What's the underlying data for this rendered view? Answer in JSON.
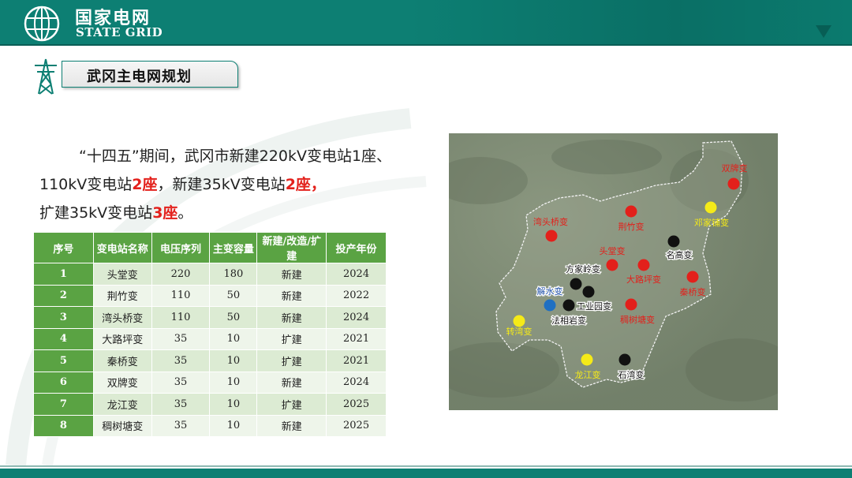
{
  "header": {
    "brand_cn": "国家电网",
    "brand_en": "STATE GRID",
    "colors": {
      "brand": "#0d7f73",
      "accent_red": "#e3201b",
      "table_green": "#5aa343"
    }
  },
  "slide": {
    "title": "武冈主电网规划",
    "para": {
      "seg1": "“十四五”期间，武冈市新建220kV变电站1座、110kV变电站",
      "seg2": "2座",
      "seg3": "，新建35kV变电站",
      "seg4": "2座，",
      "seg5": "扩建35kV变电站",
      "seg6": "3座",
      "seg7": "。"
    }
  },
  "table": {
    "headers": [
      "序号",
      "变电站名称",
      "电压序列",
      "主变容量",
      "新建/改造/扩建",
      "投产年份"
    ],
    "rows": [
      [
        "1",
        "头堂变",
        "220",
        "180",
        "新建",
        "2024"
      ],
      [
        "2",
        "荆竹变",
        "110",
        "50",
        "新建",
        "2022"
      ],
      [
        "3",
        "湾头桥变",
        "110",
        "50",
        "新建",
        "2024"
      ],
      [
        "4",
        "大路坪变",
        "35",
        "10",
        "扩建",
        "2021"
      ],
      [
        "5",
        "秦桥变",
        "35",
        "10",
        "扩建",
        "2021"
      ],
      [
        "6",
        "双牌变",
        "35",
        "10",
        "新建",
        "2024"
      ],
      [
        "7",
        "龙江变",
        "35",
        "10",
        "扩建",
        "2025"
      ],
      [
        "8",
        "稠树塘变",
        "35",
        "10",
        "新建",
        "2025"
      ]
    ]
  },
  "map": {
    "colors": {
      "red": "#e3201b",
      "yellow": "#f5ea18",
      "black": "#111111",
      "blue": "#1f6fc2"
    },
    "stations": [
      {
        "name": "双牌变",
        "color": "red"
      },
      {
        "name": "邓家铺变",
        "color": "yellow"
      },
      {
        "name": "荆竹变",
        "color": "red"
      },
      {
        "name": "湾头桥变",
        "color": "red"
      },
      {
        "name": "名高变",
        "color": "black"
      },
      {
        "name": "头堂变",
        "color": "red"
      },
      {
        "name": "方家岭变",
        "color": "black"
      },
      {
        "name": "大路坪变",
        "color": "red"
      },
      {
        "name": "秦桥变",
        "color": "red"
      },
      {
        "name": "解水变",
        "color": "blue"
      },
      {
        "name": "工业园变",
        "color": "black"
      },
      {
        "name": "法相岩变",
        "color": "black"
      },
      {
        "name": "稠树塘变",
        "color": "red"
      },
      {
        "name": "转湾变",
        "color": "yellow"
      },
      {
        "name": "龙江变",
        "color": "yellow"
      },
      {
        "name": "石湾变",
        "color": "black"
      }
    ]
  }
}
